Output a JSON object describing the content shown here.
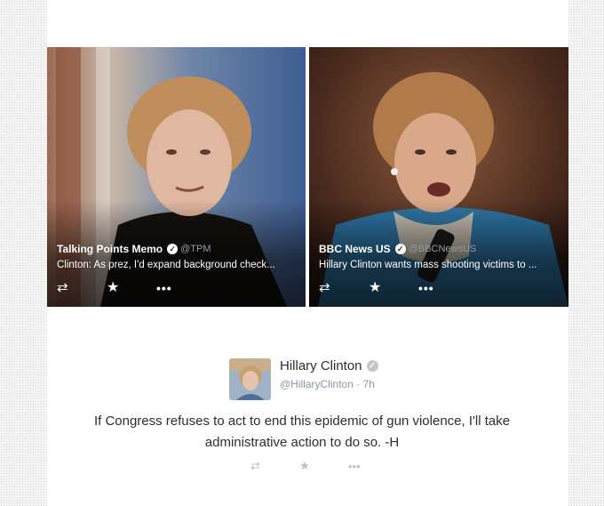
{
  "cards": [
    {
      "source_name": "Talking Points Memo",
      "handle": "@TPM",
      "headline": "Clinton: As prez, I'd expand background check..."
    },
    {
      "source_name": "BBC News US",
      "handle": "@BBCNewsUS",
      "headline": "Hillary Clinton wants mass shooting victims to ..."
    }
  ],
  "icons": {
    "retweet": "⇄",
    "favorite": "★",
    "more": "•••",
    "verified": "✓"
  },
  "tweet": {
    "author_name": "Hillary Clinton",
    "author_handle": "@HillaryClinton",
    "separator": "·",
    "time": "7h",
    "text": "If Congress refuses to act to end this epidemic of gun violence, I'll take administrative action to do so. -H"
  }
}
